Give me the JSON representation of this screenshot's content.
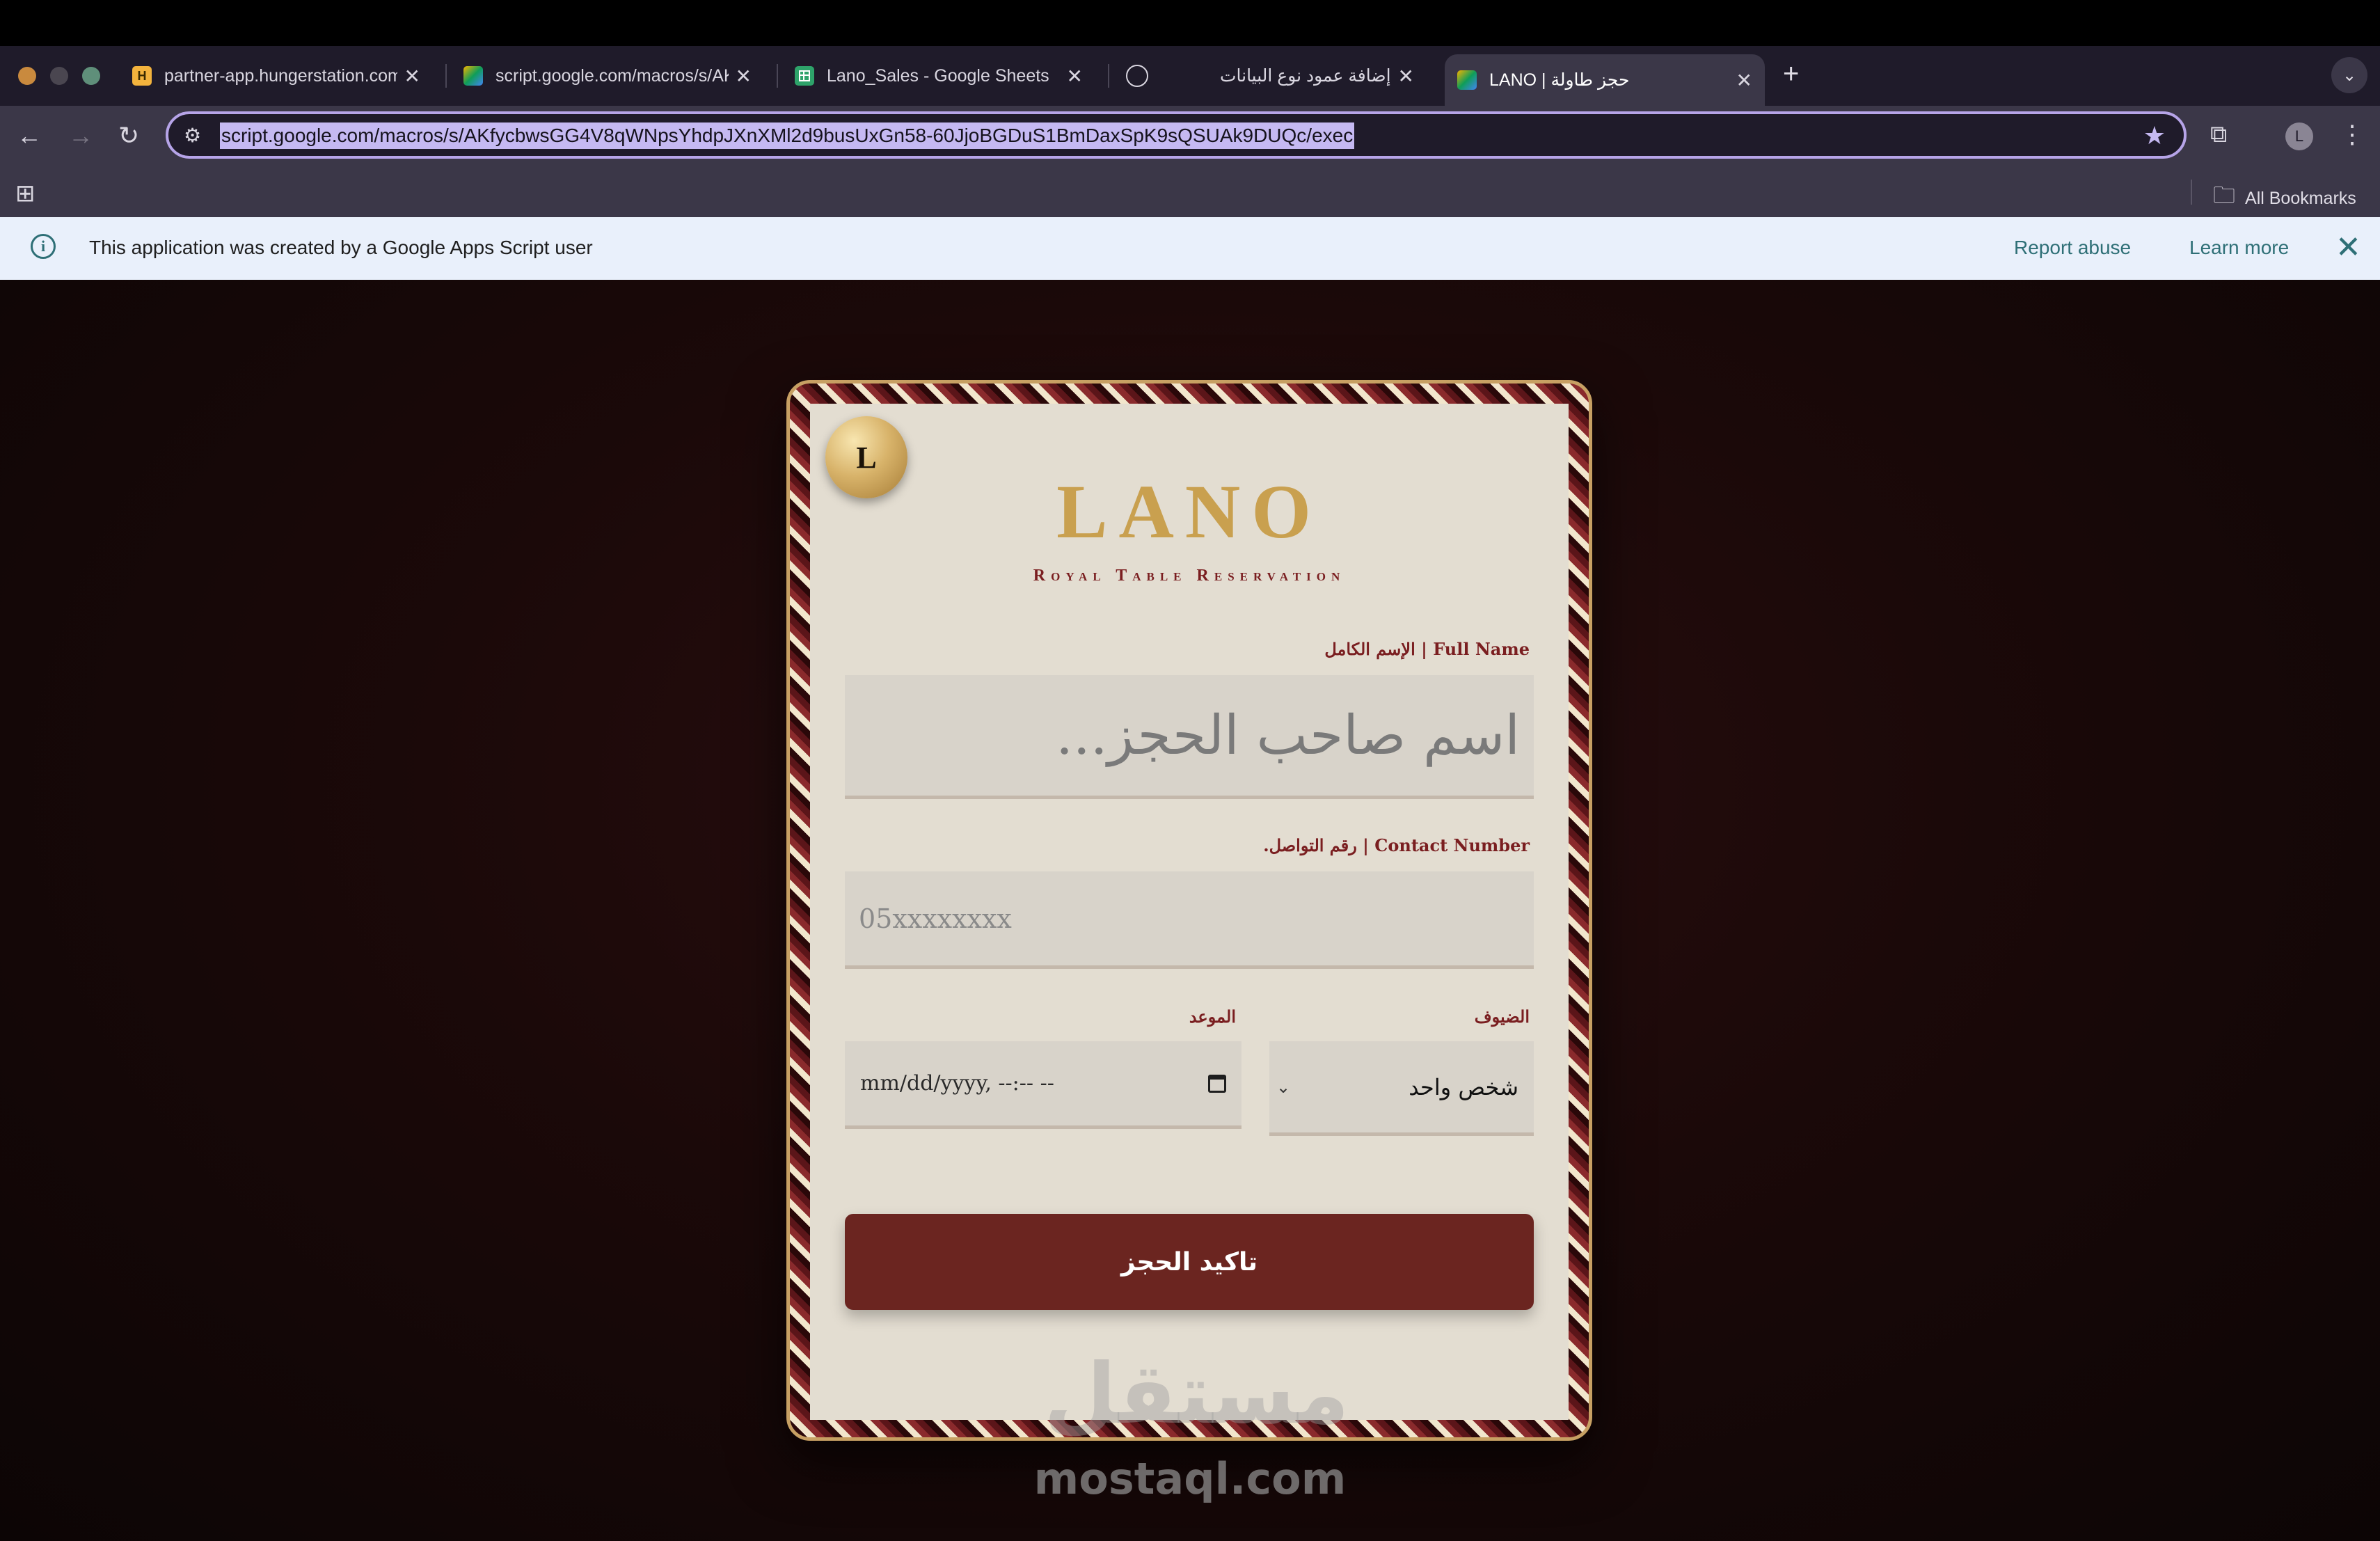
{
  "browser": {
    "tabs": [
      {
        "favicon": "H",
        "title": "partner-app.hungerstation.com",
        "close": "✕"
      },
      {
        "favicon": "apps-script-icon",
        "title": "script.google.com/macros/s/AKfy",
        "close": "✕"
      },
      {
        "favicon": "sheets-icon",
        "title": "Lano_Sales - Google Sheets",
        "close": "✕"
      },
      {
        "favicon": "chatgpt-icon",
        "title": "إضافة عمود نوع البيانات",
        "close": "✕"
      },
      {
        "favicon": "apps-script-icon",
        "title": "LANO | حجز طاولة",
        "close": "✕"
      }
    ],
    "new_tab": "+",
    "url": "script.google.com/macros/s/AKfycbwsGG4V8qWNpsYhdpJXnXMl2d9busUxGn58-60JjoBGDuS1BmDaxSpK9sQSUAk9DUQc/exec",
    "profile_initial": "L",
    "bookmarks_label": "All Bookmarks"
  },
  "infobar": {
    "message": "This application was created by a Google Apps Script user",
    "report_abuse": "Report abuse",
    "learn_more": "Learn more"
  },
  "form": {
    "medal_letter": "L",
    "brand": "LANO",
    "subtitle": "Royal Table Reservation",
    "name_label": "Full Name | الإسم الكامل",
    "name_placeholder": "اسم صاحب الحجز...",
    "phone_label": "Contact Number | رقم التواصل.",
    "phone_placeholder": "05xxxxxxxx",
    "guests_label": "الضيوف",
    "guests_value": "شخص واحد",
    "date_label": "الموعد",
    "date_placeholder": "mm/dd/yyyy, --:-- --",
    "submit_label": "تاكيد الحجز"
  },
  "watermark": {
    "arabic": "مستقل",
    "latin": "mostaql.com"
  },
  "colors": {
    "accent_gold": "#c9a04f",
    "accent_maroon": "#7a1e20",
    "button": "#6b2520",
    "card": "#e3ddd1"
  }
}
